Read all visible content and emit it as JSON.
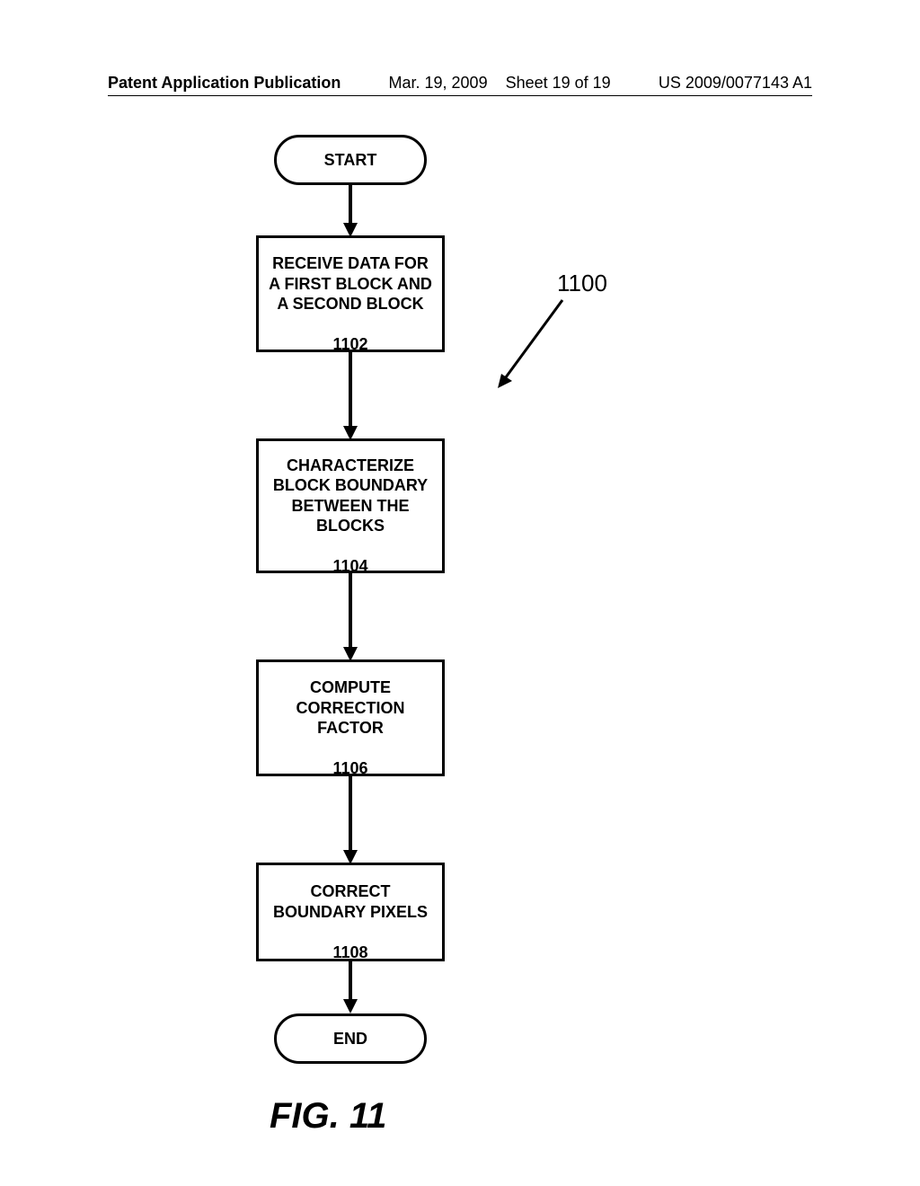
{
  "header": {
    "pubtype": "Patent Application Publication",
    "date": "Mar. 19, 2009",
    "sheet": "Sheet 19 of 19",
    "pubno": "US 2009/0077143 A1"
  },
  "flow": {
    "start": "START",
    "step1": {
      "text": "RECEIVE DATA FOR\nA FIRST BLOCK AND\nA SECOND BLOCK",
      "num": "1102"
    },
    "step2": {
      "text": "CHARACTERIZE\nBLOCK BOUNDARY\nBETWEEN THE\nBLOCKS",
      "num": "1104"
    },
    "step3": {
      "text": "COMPUTE\nCORRECTION\nFACTOR",
      "num": "1106"
    },
    "step4": {
      "text": "CORRECT\nBOUNDARY PIXELS",
      "num": "1108"
    },
    "end": "END",
    "figure_ref": "1100"
  },
  "caption": "FIG. 11"
}
